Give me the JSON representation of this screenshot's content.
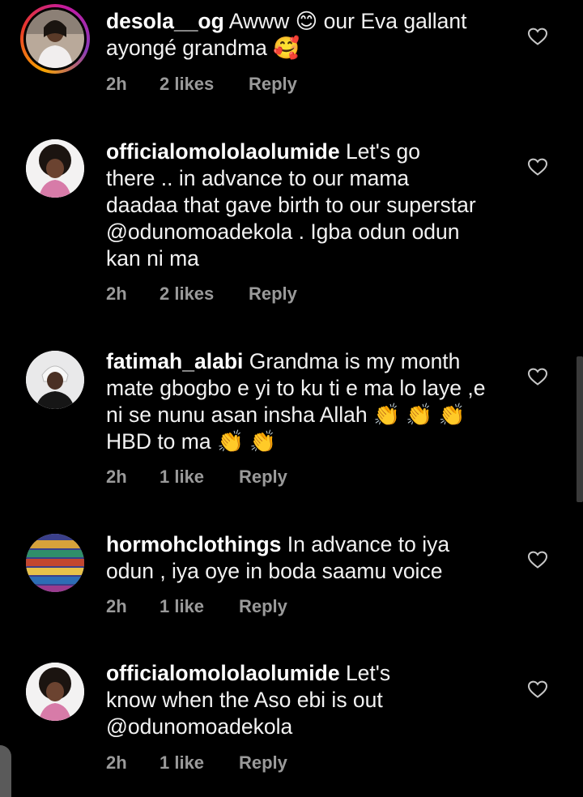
{
  "comments": [
    {
      "username": "desola__og",
      "body": " Awww 😊 our Eva gallant\nayongé grandma 🥰",
      "time": "2h",
      "likes": "2 likes",
      "reply": "Reply",
      "has_story_ring": true
    },
    {
      "username": "officialomololaolumide",
      "body": " Let's go\nthere .. in advance to our mama\ndaadaa that gave birth to our superstar\n@odunomoadekola .  Igba odun odun\nkan ni ma",
      "time": "2h",
      "likes": "2 likes",
      "reply": "Reply"
    },
    {
      "username": "fatimah_alabi",
      "body": " Grandma is my month\nmate gbogbo e yi to ku ti e ma lo laye ,e\nni se nunu asan insha Allah 👏 👏 👏\nHBD  to ma 👏 👏",
      "time": "2h",
      "likes": "1 like",
      "reply": "Reply"
    },
    {
      "username": "hormohclothings",
      "body": " In advance to iya\nodun , iya oye in  boda saamu voice",
      "time": "2h",
      "likes": "1 like",
      "reply": "Reply"
    },
    {
      "username": "officialomololaolumide",
      "body": " Let's\nknow when the Aso ebi is out\n@odunomoadekola",
      "time": "2h",
      "likes": "1 like",
      "reply": "Reply"
    }
  ],
  "icons": {
    "like": "heart-outline-icon"
  },
  "colors": {
    "background": "#000000",
    "text": "#f2f2f2",
    "meta": "#9a9a9a",
    "story_ring": [
      "#f7a400",
      "#e8372a",
      "#c21aa2",
      "#8a3ab9"
    ]
  }
}
